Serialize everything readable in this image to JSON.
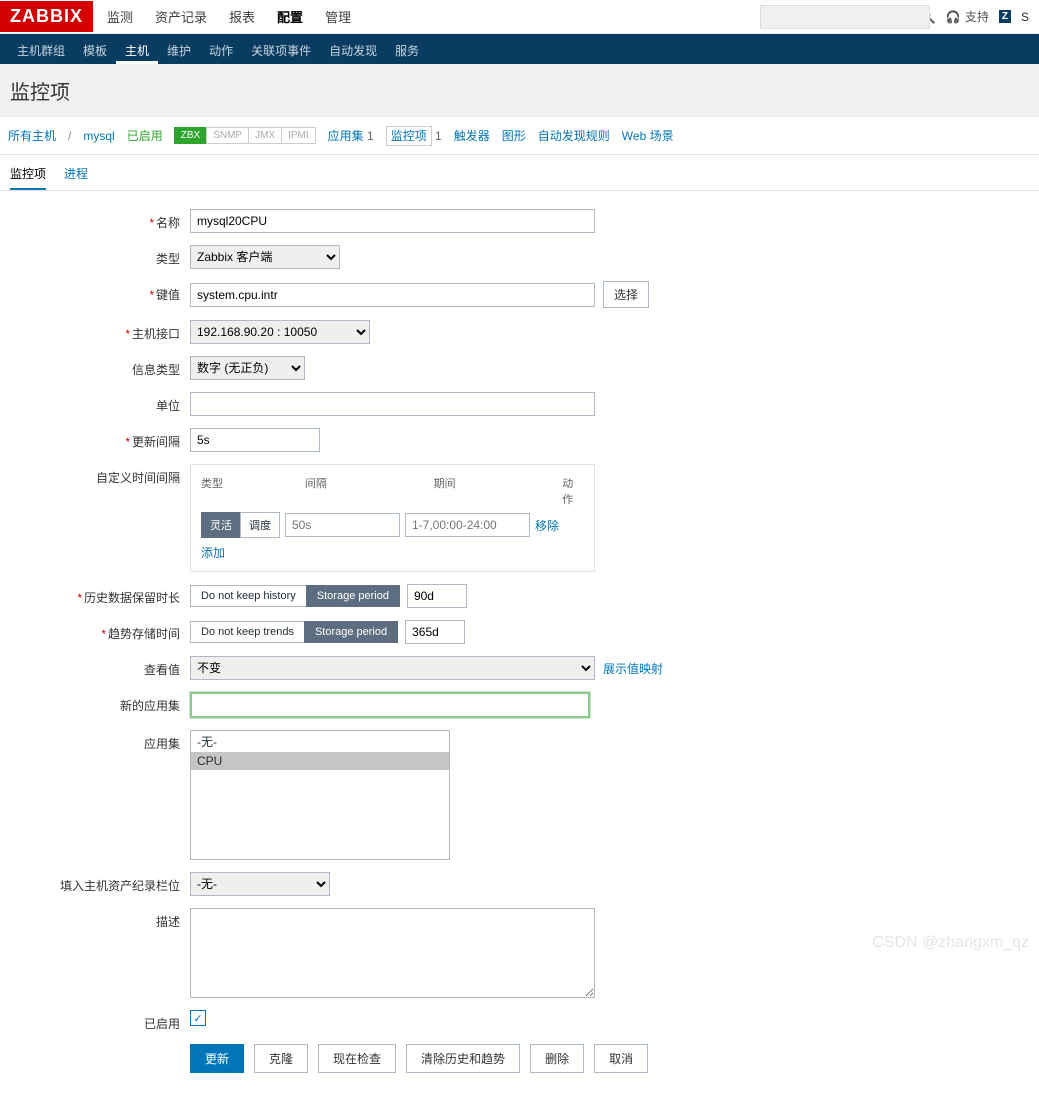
{
  "logo": "ZABBIX",
  "top_menu": [
    "监测",
    "资产记录",
    "报表",
    "配置",
    "管理"
  ],
  "top_menu_active": 3,
  "support": "支持",
  "z_label": "S",
  "sub_nav": [
    "主机群组",
    "模板",
    "主机",
    "维护",
    "动作",
    "关联项事件",
    "自动发现",
    "服务"
  ],
  "sub_nav_active": 2,
  "page_title": "监控项",
  "filter": {
    "all_hosts": "所有主机",
    "host": "mysql",
    "status": "已启用",
    "avail": [
      "ZBX",
      "SNMP",
      "JMX",
      "IPMI"
    ],
    "apps_label": "应用集",
    "apps_count": "1",
    "items_label": "监控项",
    "items_count": "1",
    "triggers": "触发器",
    "graphs": "图形",
    "discovery": "自动发现规则",
    "web": "Web 场景"
  },
  "tabs": [
    "监控项",
    "进程"
  ],
  "tabs_active": 0,
  "labels": {
    "name": "名称",
    "type": "类型",
    "key": "键值",
    "host_if": "主机接口",
    "info_type": "信息类型",
    "units": "单位",
    "update": "更新间隔",
    "custom_int": "自定义时间间隔",
    "history": "历史数据保留时长",
    "trends": "趋势存储时间",
    "show_val": "查看值",
    "new_app": "新的应用集",
    "apps": "应用集",
    "inventory": "填入主机资产纪录栏位",
    "desc": "描述",
    "enabled": "已启用"
  },
  "values": {
    "name": "mysql20CPU",
    "type": "Zabbix 客户端",
    "key": "system.cpu.intr",
    "select_btn": "选择",
    "host_if": "192.168.90.20 : 10050",
    "info_type": "数字 (无正负)",
    "units": "",
    "update": "5s",
    "show_val": "不变",
    "show_val_link": "展示值映射",
    "new_app": "",
    "inventory": "-无-",
    "desc": ""
  },
  "interval": {
    "h_type": "类型",
    "h_int": "间隔",
    "h_period": "期间",
    "h_action": "动作",
    "seg_flex": "灵活",
    "seg_sched": "调度",
    "int_ph": "50s",
    "period_ph": "1-7,00:00-24:00",
    "remove": "移除",
    "add": "添加"
  },
  "storage": {
    "no_history": "Do not keep history",
    "no_trends": "Do not keep trends",
    "period": "Storage period",
    "history_val": "90d",
    "trends_val": "365d"
  },
  "app_list": [
    "-无-",
    "CPU"
  ],
  "app_selected": 1,
  "buttons": {
    "update": "更新",
    "clone": "克隆",
    "check": "现在检查",
    "clear": "清除历史和趋势",
    "delete": "删除",
    "cancel": "取消"
  },
  "watermark": "CSDN @zhangxm_qz"
}
